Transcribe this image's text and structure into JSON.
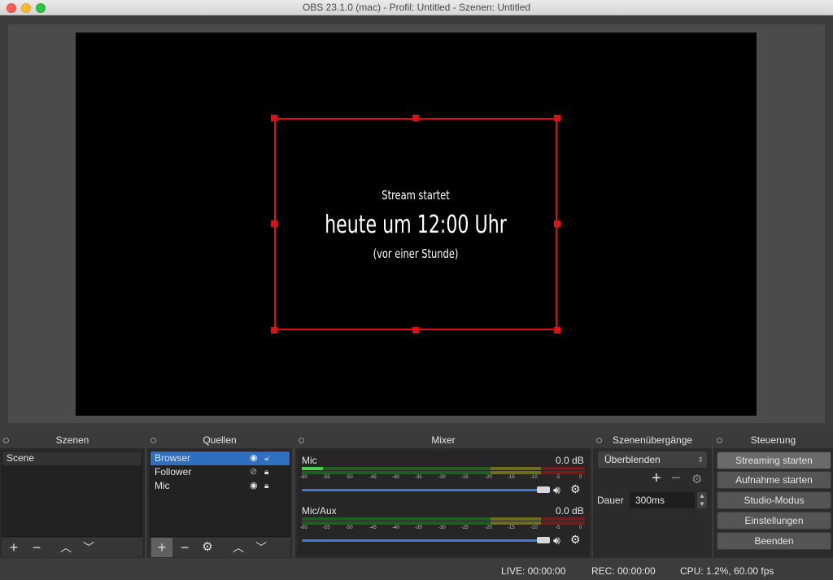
{
  "window": {
    "title": "OBS 23.1.0 (mac) - Profil: Untitled - Szenen: Untitled"
  },
  "preview": {
    "line1": "Stream startet",
    "line2": "heute um 12:00 Uhr",
    "line3": "(vor einer Stunde)",
    "selection_color": "#e01010"
  },
  "docks": {
    "scenes": {
      "title": "Szenen",
      "items": [
        "Scene"
      ]
    },
    "sources": {
      "title": "Quellen",
      "items": [
        {
          "label": "Browser",
          "selected": true,
          "visible": true
        },
        {
          "label": "Follower",
          "selected": false,
          "visible": false
        },
        {
          "label": "Mic",
          "selected": false,
          "visible": true
        }
      ]
    },
    "mixer": {
      "title": "Mixer",
      "channels": [
        {
          "name": "Mic",
          "db": "0.0 dB"
        },
        {
          "name": "Mic/Aux",
          "db": "0.0 dB"
        }
      ],
      "ticks": [
        "-60",
        "-55",
        "-50",
        "-45",
        "-40",
        "-35",
        "-30",
        "-25",
        "-20",
        "-15",
        "-10",
        "-5",
        "0"
      ]
    },
    "transitions": {
      "title": "Szenenübergänge",
      "selected": "Überblenden",
      "duration_label": "Dauer",
      "duration_value": "300ms"
    },
    "controls": {
      "title": "Steuerung",
      "buttons": [
        "Streaming starten",
        "Aufnahme starten",
        "Studio-Modus",
        "Einstellungen",
        "Beenden"
      ]
    }
  },
  "statusbar": {
    "live": "LIVE: 00:00:00",
    "rec": "REC: 00:00:00",
    "cpu": "CPU: 1.2%, 60.00 fps"
  },
  "colors": {
    "accent": "#2f6fbf",
    "meter_green": "#2d8a2d",
    "meter_yellow": "#8a8a2d",
    "meter_red": "#8a2d2d"
  }
}
